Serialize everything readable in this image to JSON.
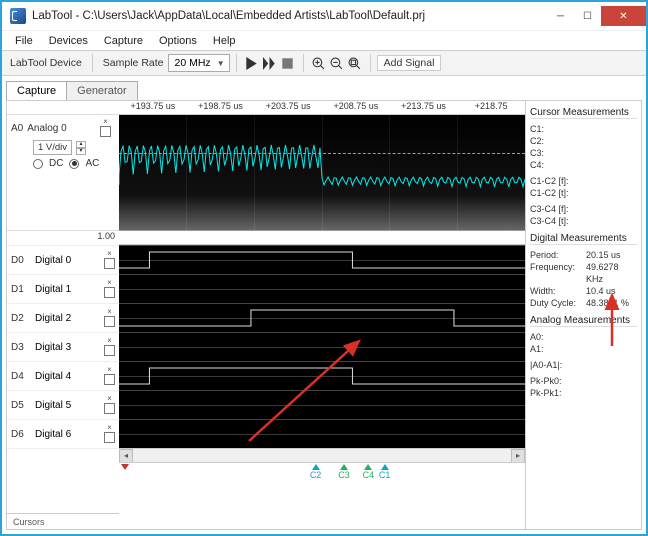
{
  "window": {
    "title": "LabTool - C:\\Users\\Jack\\AppData\\Local\\Embedded Artists\\LabTool\\Default.prj"
  },
  "menu": {
    "file": "File",
    "devices": "Devices",
    "capture": "Capture",
    "options": "Options",
    "help": "Help"
  },
  "toolbar": {
    "device_label": "LabTool Device",
    "sample_rate_label": "Sample Rate",
    "sample_rate_value": "20 MHz",
    "add_signal": "Add Signal"
  },
  "tabs": {
    "capture": "Capture",
    "generator": "Generator"
  },
  "time_ruler": [
    "+193.75 us",
    "+198.75 us",
    "+203.75 us",
    "+208.75 us",
    "+213.75 us",
    "+218.75"
  ],
  "analog": {
    "id": "A0",
    "name": "Analog 0",
    "vdiv": "1 V/div",
    "dc": "DC",
    "ac": "AC",
    "scale_bottom": "1.00"
  },
  "digital": [
    {
      "id": "D0",
      "name": "Digital 0"
    },
    {
      "id": "D1",
      "name": "Digital 1"
    },
    {
      "id": "D2",
      "name": "Digital 2"
    },
    {
      "id": "D3",
      "name": "Digital 3"
    },
    {
      "id": "D4",
      "name": "Digital 4"
    },
    {
      "id": "D5",
      "name": "Digital 5"
    },
    {
      "id": "D6",
      "name": "Digital 6"
    }
  ],
  "cursors_label": "Cursors",
  "cursor_markers": {
    "c1": "C1",
    "c2": "C2",
    "c3": "C3",
    "c4": "C4"
  },
  "side": {
    "cursor_title": "Cursor Measurements",
    "c1": "C1:",
    "c2": "C2:",
    "c3": "C3:",
    "c4": "C4:",
    "c12f": "C1-C2 [f]:",
    "c12t": "C1-C2 [t]:",
    "c34f": "C3-C4 [f]:",
    "c34t": "C3-C4 [t]:",
    "digital_title": "Digital Measurements",
    "period_k": "Period:",
    "period_v": "20.15 us",
    "freq_k": "Frequency:",
    "freq_v": "49.6278 KHz",
    "width_k": "Width:",
    "width_v": "10.4 us",
    "duty_k": "Duty Cycle:",
    "duty_v": "48.3871 %",
    "analog_title": "Analog Measurements",
    "a0": "A0:",
    "a1": "A1:",
    "a0a1": "|A0-A1|:",
    "pk0": "Pk-Pk0:",
    "pk1": "Pk-Pk1:"
  }
}
